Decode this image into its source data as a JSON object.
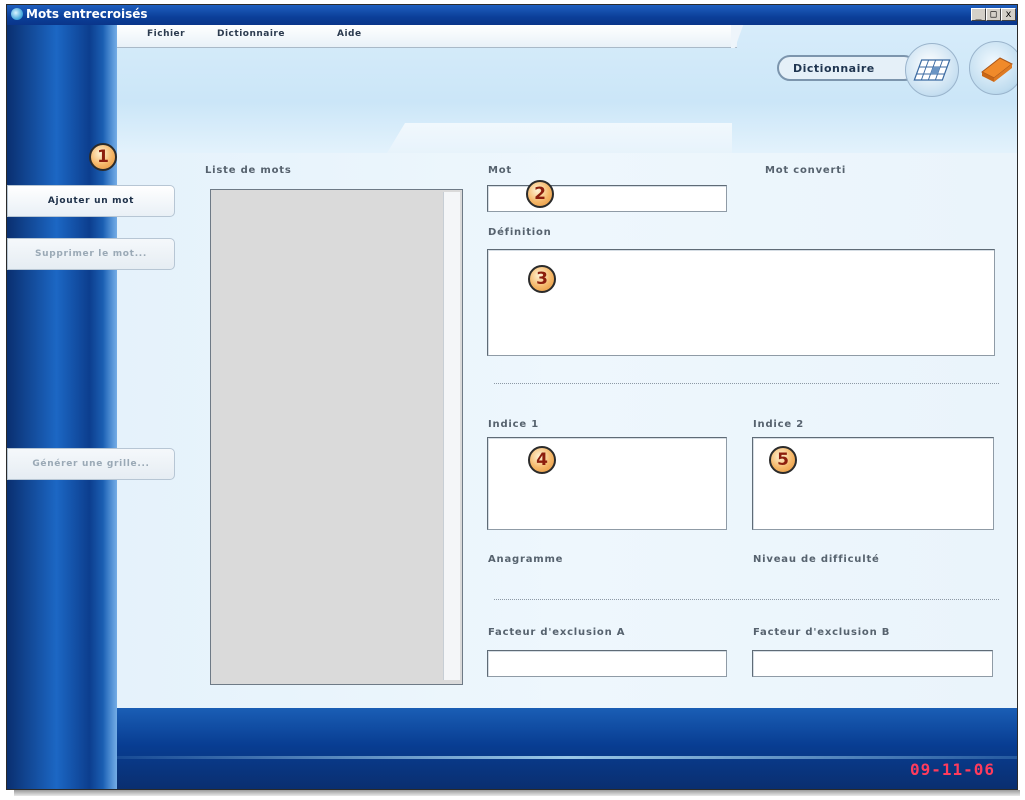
{
  "window": {
    "title": "Mots entrecroisés",
    "controls": {
      "minimize": "_",
      "maximize": "□",
      "close": "x"
    }
  },
  "menu": {
    "items": [
      "Fichier",
      "Dictionnaire",
      "Aide"
    ]
  },
  "header": {
    "mode_label": "Dictionnaire",
    "icons": [
      "crossword-grid-icon",
      "eraser-icon"
    ]
  },
  "sidebar": {
    "add_word": "Ajouter un mot",
    "delete_word": "Supprimer le mot...",
    "generate_grid": "Générer une grille..."
  },
  "form": {
    "word_list_label": "Liste de mots",
    "word_label": "Mot",
    "converted_label": "Mot converti",
    "definition_label": "Définition",
    "clue1_label": "Indice 1",
    "clue2_label": "Indice 2",
    "anagram_label": "Anagramme",
    "difficulty_label": "Niveau de difficulté",
    "exclusion_a_label": "Facteur d'exclusion A",
    "exclusion_b_label": "Facteur d'exclusion B"
  },
  "callouts": [
    "1",
    "2",
    "3",
    "4",
    "5"
  ],
  "watermark": "09-11-06",
  "colors": {
    "title_bar": "#0b3f99",
    "left_band": "#1c67c4",
    "panel": "#eaf4fb",
    "badge_fill": "#f5b667",
    "badge_text": "#8c1e0d",
    "watermark": "#ff3b5c"
  }
}
